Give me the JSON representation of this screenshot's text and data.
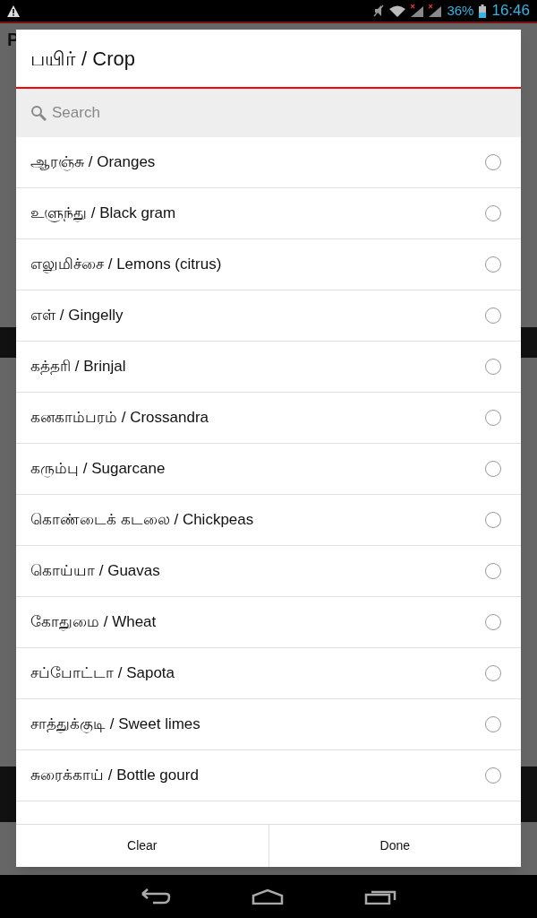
{
  "status_bar": {
    "battery": "36%",
    "time": "16:46"
  },
  "background": {
    "title": "P"
  },
  "dialog": {
    "title": "பயிர் / Crop",
    "search": {
      "placeholder": "Search"
    },
    "items": [
      {
        "label": "ஆரஞ்சு / Oranges",
        "selected": false
      },
      {
        "label": "உளுந்து / Black gram",
        "selected": false
      },
      {
        "label": "எலுமிச்சை / Lemons (citrus)",
        "selected": false
      },
      {
        "label": "எள் / Gingelly",
        "selected": false
      },
      {
        "label": "கத்தரி / Brinjal",
        "selected": false
      },
      {
        "label": "கனகாம்பரம் / Crossandra",
        "selected": false
      },
      {
        "label": "கரும்பு / Sugarcane",
        "selected": false
      },
      {
        "label": "கொண்டைக் கடலை / Chickpeas",
        "selected": false
      },
      {
        "label": "கொய்யா / Guavas",
        "selected": false
      },
      {
        "label": "கோதுமை / Wheat",
        "selected": false
      },
      {
        "label": "சப்போட்டா / Sapota",
        "selected": false
      },
      {
        "label": "சாத்துக்குடி / Sweet limes",
        "selected": false
      },
      {
        "label": "சுரைக்காய் / Bottle gourd",
        "selected": false
      }
    ],
    "buttons": [
      "Clear",
      "Done"
    ]
  }
}
